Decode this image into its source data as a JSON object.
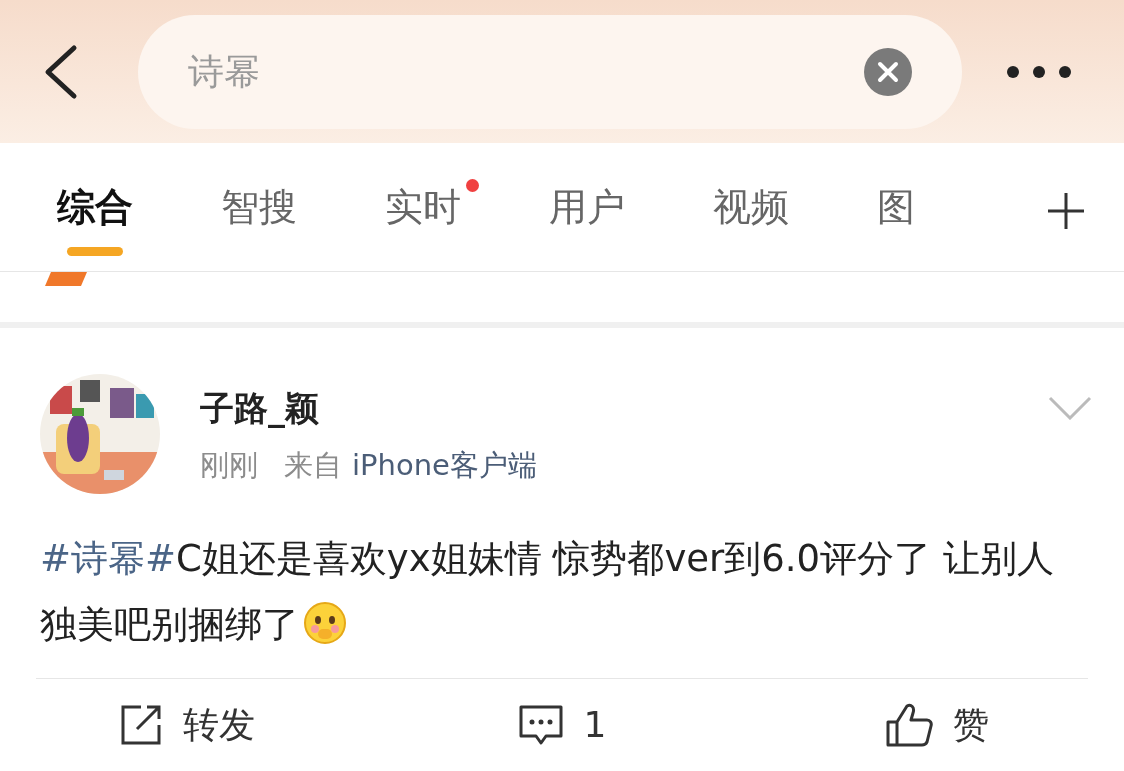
{
  "search": {
    "value": "诗幂"
  },
  "tabs": [
    {
      "label": "综合",
      "selected": true,
      "dot": false
    },
    {
      "label": "智搜",
      "selected": false,
      "dot": false
    },
    {
      "label": "实时",
      "selected": false,
      "dot": true
    },
    {
      "label": "用户",
      "selected": false,
      "dot": false
    },
    {
      "label": "视频",
      "selected": false,
      "dot": false
    },
    {
      "label": "图",
      "selected": false,
      "dot": false
    }
  ],
  "post": {
    "author": "子路_颖",
    "time": "刚刚",
    "source_prefix": "来自",
    "source": "iPhone客户端",
    "body": [
      {
        "kind": "hashtag",
        "text": "#诗幂#"
      },
      {
        "kind": "text",
        "text": "C姐还是喜欢yx姐妹情 惊势都ver到6.0评分了 让别人独美吧别捆绑了"
      },
      {
        "kind": "emoji"
      }
    ],
    "actions": [
      {
        "kind": "repost",
        "label": "转发"
      },
      {
        "kind": "comment",
        "label": "1"
      },
      {
        "kind": "like",
        "label": "赞"
      }
    ]
  }
}
